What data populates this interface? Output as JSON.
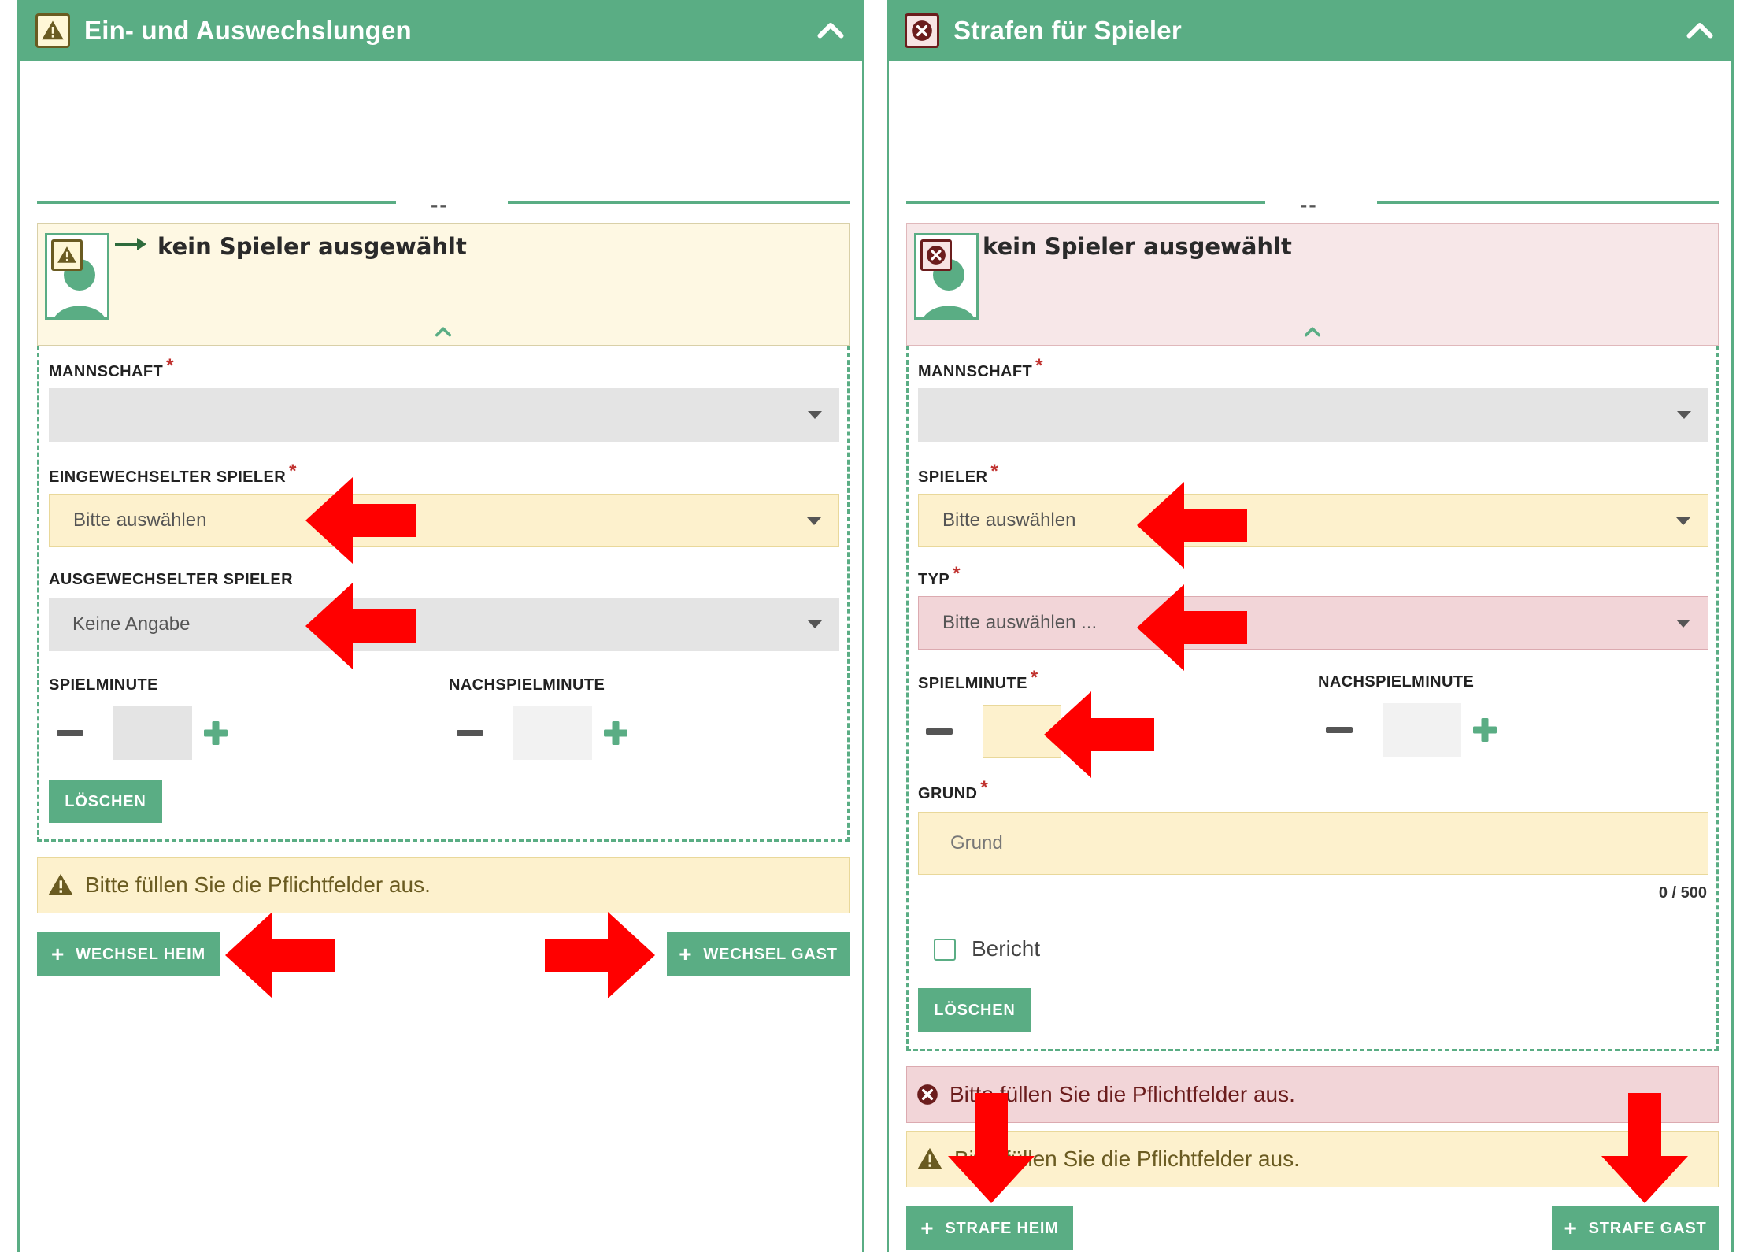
{
  "colors": {
    "accent": "#5aad84",
    "warn_bg": "#fdf1cd",
    "danger_bg": "#f2d5d8",
    "required": "#c0322f",
    "annotation_arrow": "#ff0000"
  },
  "left": {
    "title": "Ein- und Auswechslungen",
    "header_icon": "warning-triangle-icon",
    "separator": "--",
    "player_card": {
      "title": "kein Spieler ausgewählt",
      "status": "warning"
    },
    "fields": {
      "team": {
        "label": "MANNSCHAFT",
        "value": ""
      },
      "player_in": {
        "label": "EINGEWECHSELTER SPIELER",
        "value": "Bitte auswählen"
      },
      "player_out": {
        "label": "AUSGEWECHSELTER SPIELER",
        "value": "Keine Angabe"
      },
      "minute": {
        "label": "SPIELMINUTE"
      },
      "extra_minute": {
        "label": "NACHSPIELMINUTE"
      }
    },
    "delete_label": "LÖSCHEN",
    "alert": "Bitte füllen Sie die Pflichtfelder aus.",
    "btn_home": "WECHSEL HEIM",
    "btn_away": "WECHSEL GAST"
  },
  "right": {
    "title": "Strafen für Spieler",
    "header_icon": "error-circle-icon",
    "separator": "--",
    "player_card": {
      "title": "kein Spieler ausgewählt",
      "status": "error"
    },
    "fields": {
      "team": {
        "label": "MANNSCHAFT",
        "value": ""
      },
      "player": {
        "label": "SPIELER",
        "value": "Bitte auswählen"
      },
      "type": {
        "label": "TYP",
        "value": "Bitte auswählen ..."
      },
      "minute": {
        "label": "SPIELMINUTE"
      },
      "extra_minute": {
        "label": "NACHSPIELMINUTE"
      },
      "reason": {
        "label": "GRUND",
        "placeholder": "Grund",
        "counter": "0 / 500"
      },
      "report": {
        "label": "Bericht"
      }
    },
    "delete_label": "LÖSCHEN",
    "alert_error": "Bitte füllen Sie die Pflichtfelder aus.",
    "alert_warn": "Bitte füllen Sie die Pflichtfelder aus.",
    "btn_home": "STRAFE HEIM",
    "btn_away": "STRAFE GAST"
  }
}
